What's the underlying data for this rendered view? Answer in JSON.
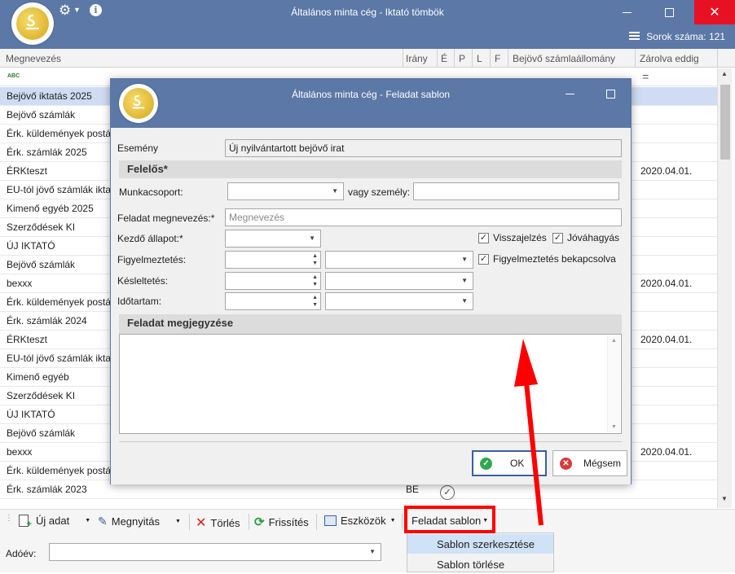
{
  "main": {
    "title": "Általános minta cég - Iktató tömbök",
    "row_count_label": "Sorok száma: 121"
  },
  "grid": {
    "columns": [
      "Megnevezés",
      "Irány",
      "É",
      "P",
      "L",
      "F",
      "Bejövő számlaállomány",
      "Zárolva eddig"
    ],
    "filter_icon_text": "ABC",
    "filter_eq": "=",
    "rows": [
      {
        "name": "Bejövő iktatás 2025",
        "irany": "",
        "date": "",
        "selected": true
      },
      {
        "name": "Bejövő számlák",
        "irany": "",
        "date": ""
      },
      {
        "name": "Érk. küldemények postá",
        "irany": "",
        "date": ""
      },
      {
        "name": "Érk. számlák 2025",
        "irany": "",
        "date": ""
      },
      {
        "name": "ÉRKteszt",
        "irany": "",
        "date": "2020.04.01."
      },
      {
        "name": "EU-tól jövő számlák ikta",
        "irany": "",
        "date": ""
      },
      {
        "name": "Kimenő egyéb 2025",
        "irany": "",
        "date": ""
      },
      {
        "name": "Szerződések KI",
        "irany": "",
        "date": ""
      },
      {
        "name": "ÚJ IKTATÓ",
        "irany": "",
        "date": ""
      },
      {
        "name": "Bejövő számlák",
        "irany": "",
        "date": ""
      },
      {
        "name": "bexxx",
        "irany": "",
        "date": "2020.04.01."
      },
      {
        "name": "Érk. küldemények postá",
        "irany": "",
        "date": ""
      },
      {
        "name": "Érk. számlák 2024",
        "irany": "",
        "date": ""
      },
      {
        "name": "ÉRKteszt",
        "irany": "",
        "date": "2020.04.01."
      },
      {
        "name": "EU-tól jövő számlák ikta",
        "irany": "",
        "date": ""
      },
      {
        "name": "Kimenő egyéb",
        "irany": "",
        "date": ""
      },
      {
        "name": "Szerződések KI",
        "irany": "",
        "date": ""
      },
      {
        "name": "ÚJ IKTATÓ",
        "irany": "",
        "date": ""
      },
      {
        "name": "Bejövő számlák",
        "irany": "",
        "date": ""
      },
      {
        "name": "bexxx",
        "irany": "",
        "date": "2020.04.01."
      },
      {
        "name": "Érk. küldemények postá",
        "irany": "",
        "date": ""
      },
      {
        "name": "Érk. számlák 2023",
        "irany": "BE",
        "date": ""
      }
    ]
  },
  "toolbar": {
    "new": "Új adat",
    "open": "Megnyitás",
    "delete": "Törlés",
    "refresh": "Frissítés",
    "tools": "Eszközök",
    "template": "Feladat sablon"
  },
  "menu": {
    "edit": "Sablon szerkesztése",
    "delete": "Sablon törlése"
  },
  "adoev": {
    "label": "Adóév:",
    "value": ""
  },
  "dialog": {
    "title": "Általános minta cég - Feladat sablon",
    "event_label": "Esemény",
    "event_value": "Új nyilvántartott bejövő irat",
    "responsible_section": "Felelős*",
    "workgroup_label": "Munkacsoport:",
    "or_person_label": "vagy személy:",
    "task_name_label": "Feladat megnevezés:*",
    "task_name_placeholder": "Megnevezés",
    "start_state_label": "Kezdő állapot:*",
    "warning_label": "Figyelmeztetés:",
    "delay_label": "Késleltetés:",
    "duration_label": "Időtartam:",
    "feedback_label": "Visszajelzés",
    "approval_label": "Jóváhagyás",
    "warning_enabled_label": "Figyelmeztetés bekapcsolva",
    "note_section": "Feladat megjegyzése",
    "ok_label": "OK",
    "cancel_label": "Mégsem"
  },
  "colors": {
    "titlebar": "#5b78a6",
    "close": "#e81123",
    "selected_row": "#cfdcf3",
    "annotation": "#ff0000"
  }
}
